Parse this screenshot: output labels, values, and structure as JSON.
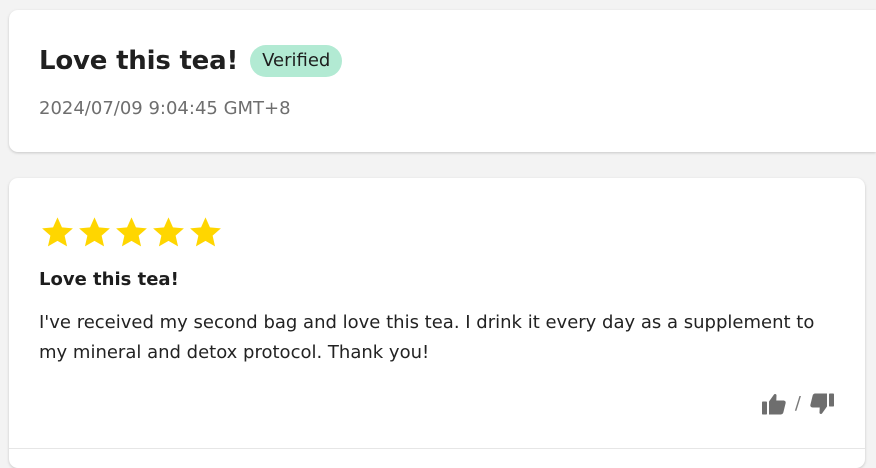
{
  "header": {
    "title": "Love this tea!",
    "badge": "Verified",
    "timestamp": "2024/07/09 9:04:45 GMT+8"
  },
  "review": {
    "rating": 5,
    "max_rating": 5,
    "title": "Love this tea!",
    "body": "I've received my second bag and love this tea. I drink it every day as a supplement to my mineral and detox protocol. Thank you!",
    "vote_separator": "/"
  },
  "icons": {
    "star": "star-icon",
    "helpful": "thumbs-up-icon",
    "not_helpful": "thumbs-down-icon"
  },
  "colors": {
    "star": "#FFD600",
    "badge_bg": "#B2EAD3",
    "vote_icon": "#6E6E6E",
    "timestamp": "#6E6E6E"
  }
}
